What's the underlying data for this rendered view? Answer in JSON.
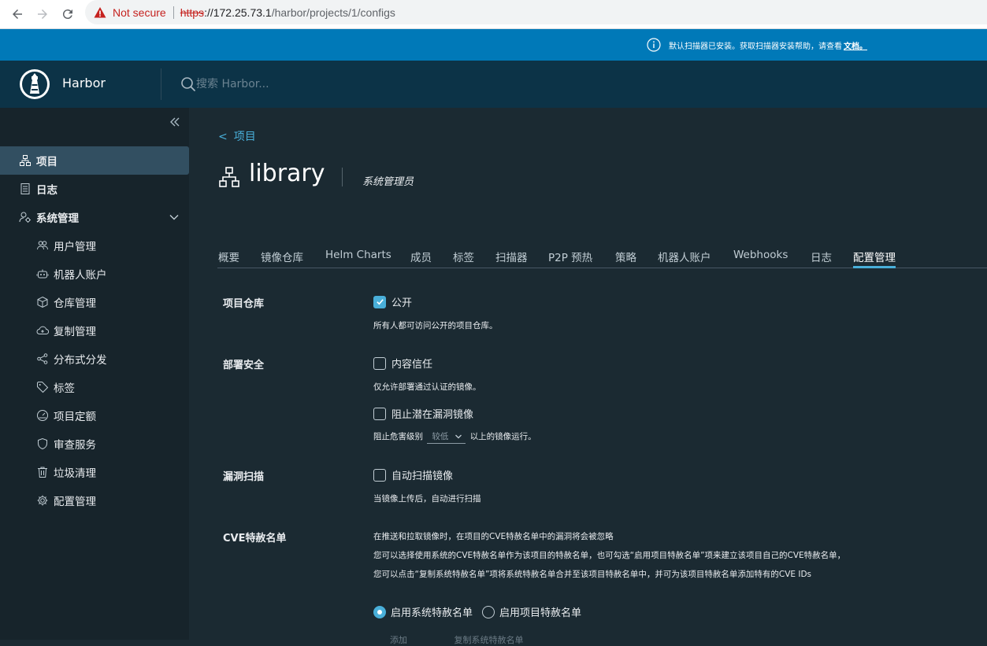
{
  "browser": {
    "security_label": "Not secure",
    "url_scheme": "https",
    "url_host": "://172.25.73.1",
    "url_path": "/harbor/projects/1/configs"
  },
  "banner": {
    "message": "默认扫描器已安装。获取扫描器安装帮助，请查看",
    "link": "文档。"
  },
  "header": {
    "brand": "Harbor",
    "search_placeholder": "搜索 Harbor..."
  },
  "sidebar": {
    "items": [
      {
        "label": "项目",
        "icon": "projects-icon"
      },
      {
        "label": "日志",
        "icon": "logs-icon"
      },
      {
        "label": "系统管理",
        "icon": "admin-icon"
      }
    ],
    "sub_items": [
      {
        "label": "用户管理",
        "icon": "users-icon"
      },
      {
        "label": "机器人账户",
        "icon": "robot-icon"
      },
      {
        "label": "仓库管理",
        "icon": "registry-icon"
      },
      {
        "label": "复制管理",
        "icon": "cloud-replication-icon"
      },
      {
        "label": "分布式分发",
        "icon": "share-icon"
      },
      {
        "label": "标签",
        "icon": "tag-icon"
      },
      {
        "label": "项目定额",
        "icon": "dashboard-icon"
      },
      {
        "label": "审查服务",
        "icon": "shield-icon"
      },
      {
        "label": "垃圾清理",
        "icon": "trash-icon"
      },
      {
        "label": "配置管理",
        "icon": "gear-icon"
      }
    ]
  },
  "main": {
    "back_link": "项目",
    "project_name": "library",
    "role": "系统管理员",
    "tabs": [
      "概要",
      "镜像仓库",
      "Helm Charts",
      "成员",
      "标签",
      "扫描器",
      "P2P 预热",
      "策略",
      "机器人账户",
      "Webhooks",
      "日志",
      "配置管理"
    ],
    "active_tab": "配置管理"
  },
  "config": {
    "registry": {
      "label": "项目仓库",
      "public_label": "公开",
      "public_checked": true,
      "public_help": "所有人都可访问公开的项目仓库。"
    },
    "deployment": {
      "label": "部署安全",
      "content_trust_label": "内容信任",
      "content_trust_checked": false,
      "content_trust_help": "仅允许部署通过认证的镜像。",
      "prevent_vul_label": "阻止潜在漏洞镜像",
      "prevent_vul_checked": false,
      "severity_prefix": "阻止危害级别",
      "severity_value": "较低",
      "severity_suffix": "以上的镜像运行。"
    },
    "scan": {
      "label": "漏洞扫描",
      "auto_scan_label": "自动扫描镜像",
      "auto_scan_checked": false,
      "auto_scan_help": "当镜像上传后，自动进行扫描"
    },
    "cve": {
      "label": "CVE特赦名单",
      "line1": "在推送和拉取镜像时，在项目的CVE特赦名单中的漏洞将会被忽略",
      "line2": "您可以选择使用系统的CVE特赦名单作为该项目的特赦名单，也可勾选“启用项目特赦名单”项来建立该项目自己的CVE特赦名单，",
      "line3": "您可以点击“复制系统特赦名单”项将系统特赦名单合并至该项目特赦名单中，并可为该项目特赦名单添加特有的CVE IDs",
      "system_option": "启用系统特赦名单",
      "project_option": "启用项目特赦名单",
      "selected": "system",
      "add_label": "添加",
      "copy_label": "复制系统特赦名单"
    }
  },
  "colors": {
    "accent": "#49afd9",
    "banner": "#0079b8",
    "header": "#0c3347",
    "sidebar": "#17242b",
    "main": "#1b2a32"
  }
}
